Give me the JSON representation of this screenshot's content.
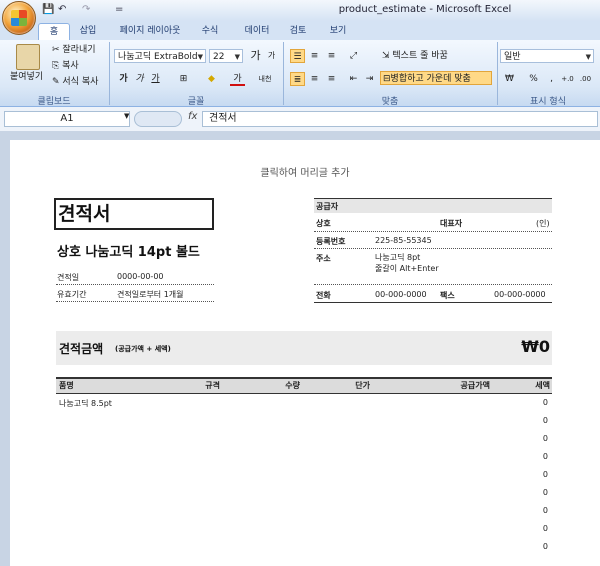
{
  "window": {
    "title": "product_estimate - Microsoft Excel"
  },
  "qat": {
    "save": "💾",
    "undo": "↶",
    "redo": "↷",
    "more": "="
  },
  "tabs": [
    "홈",
    "삽입",
    "페이지 레이아웃",
    "수식",
    "데이터",
    "검토",
    "보기"
  ],
  "ribbon": {
    "clipboard": {
      "paste": "붙여넣기",
      "cut": "잘라내기",
      "copy": "복사",
      "format_painter": "서식 복사",
      "label": "클립보드"
    },
    "font": {
      "name": "나눔고딕 ExtraBold",
      "size": "22",
      "label": "글꼴",
      "grow": "가",
      "shrink": "가",
      "bold": "가",
      "italic": "가",
      "underline": "가",
      "border": "⊞",
      "fill": "◆",
      "color": "가",
      "phonetic": "내천"
    },
    "alignment": {
      "wrap": "텍스트 줄 바꿈",
      "merge": "병합하고 가운데 맞춤",
      "label": "맞춤"
    },
    "number": {
      "format": "일반",
      "currency": "₩",
      "percent": "%",
      "comma": ",",
      "inc": "+.0",
      "dec": ".00",
      "label": "표시 형식"
    }
  },
  "formula_bar": {
    "cell": "A1",
    "fx": "fx",
    "value": "견적서"
  },
  "sheet": {
    "header_hint": "클릭하여 머리글 추가",
    "title": "견적서",
    "company": "상호 나눔고딕 14pt 볼드",
    "date_label": "견적일",
    "date_value": "0000-00-00",
    "valid_label": "유효기간",
    "valid_value": "견적일로부터 1개월",
    "supplier": {
      "title": "공급자",
      "name_label": "상호",
      "rep_label": "대표자",
      "seal": "(인)",
      "reg_label": "등록번호",
      "reg_value": "225-85-55345",
      "addr_label": "주소",
      "addr_line1": "나눔고딕 8pt",
      "addr_line2": "줄갈이 Alt+Enter",
      "tel_label": "전화",
      "tel_value": "00-000-0000",
      "fax_label": "팩스",
      "fax_value": "00-000-0000"
    },
    "total": {
      "label": "견적금액",
      "sub": "(공급가액 + 세액)",
      "value": "₩0"
    },
    "table": {
      "headers": [
        "품명",
        "규격",
        "수량",
        "단가",
        "공급가액",
        "세액"
      ],
      "first_item": "나눔고딕 8.5pt",
      "tax_values": [
        "0",
        "0",
        "0",
        "0",
        "0",
        "0",
        "0",
        "0",
        "0"
      ]
    }
  }
}
